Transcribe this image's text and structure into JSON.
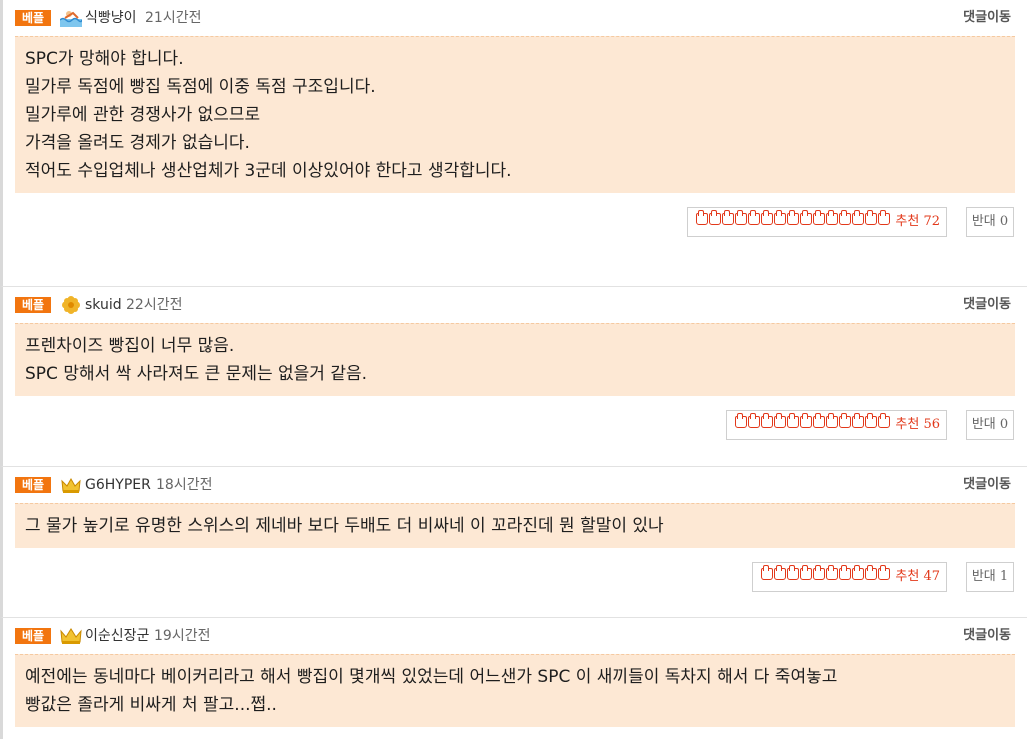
{
  "comments": [
    {
      "badge": "베플",
      "avatar_icon": "swimmer-icon",
      "nickname": "식빵냥이",
      "time": "21시간전",
      "move_label": "댓글이동",
      "lines": [
        "SPC가 망해야 합니다.",
        "밀가루 독점에 빵집 독점에 이중 독점 구조입니다.",
        "",
        "밀가루에 관한 경쟁사가 없으므로",
        "가격을 올려도 경제가 없습니다.",
        "적어도 수입업체나 생산업체가 3군데 이상있어야 한다고 생각합니다."
      ],
      "upvote_label": "추천 72",
      "upvote_icons": 15,
      "downvote_label": "반대 0"
    },
    {
      "badge": "베플",
      "avatar_icon": "flower-icon",
      "nickname": "skuid",
      "time": "22시간전",
      "move_label": "댓글이동",
      "lines": [
        "프렌차이즈 빵집이 너무 많음.",
        "SPC 망해서 싹 사라져도 큰 문제는 없을거 같음."
      ],
      "upvote_label": "추천 56",
      "upvote_icons": 12,
      "downvote_label": "반대 0"
    },
    {
      "badge": "베플",
      "avatar_icon": "crown-icon",
      "nickname": "G6HYPER",
      "time": "18시간전",
      "move_label": "댓글이동",
      "lines": [
        "그 물가 높기로 유명한 스위스의 제네바 보다 두배도 더 비싸네 이 꼬라진데 뭔 할말이 있나"
      ],
      "upvote_label": "추천 47",
      "upvote_icons": 10,
      "downvote_label": "반대 1"
    },
    {
      "badge": "베플",
      "avatar_icon": "crown-icon",
      "nickname": "이순신장군",
      "time": "19시간전",
      "move_label": "댓글이동",
      "lines": [
        "예전에는 동네마다 베이커리라고 해서 빵집이 몇개씩 있었는데 어느샌가 SPC 이 새끼들이 독차지 해서 다 죽여놓고",
        "빵값은 졸라게 비싸게 처 팔고...쩝.."
      ]
    }
  ]
}
